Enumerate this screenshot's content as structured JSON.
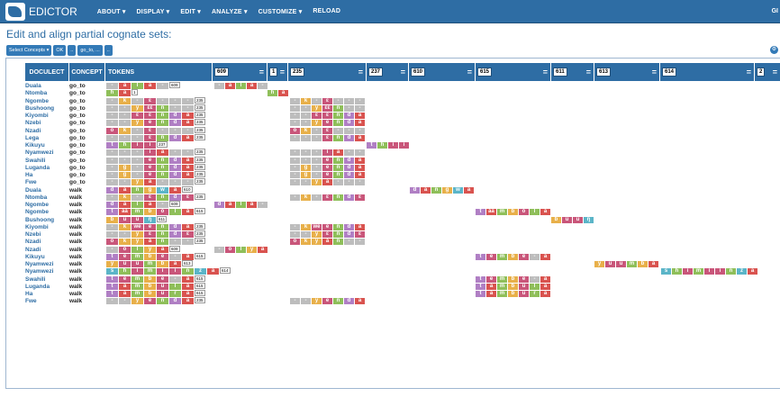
{
  "nav": {
    "brand": "EDICTOR",
    "items": [
      "ABOUT ▾",
      "DISPLAY ▾",
      "EDIT ▾",
      "ANALYZE ▾",
      "CUSTOMIZE ▾",
      "RELOAD"
    ],
    "right": "GI"
  },
  "page": {
    "title": "Edit and align partial cognate sets:"
  },
  "toolbar": {
    "select": "Select Concepts ▾",
    "ok": "OK",
    "prev": "..",
    "concept": "go_to, ...",
    "next": ".."
  },
  "table": {
    "headers": {
      "doculect": "DOCULECT",
      "concept": "CONCEPT",
      "tokens": "TOKENS"
    },
    "cogsets": [
      "609",
      "1",
      "235",
      "237",
      "610",
      "615",
      "611",
      "613",
      "614",
      "2"
    ],
    "rows": [
      {
        "doculect": "Duala",
        "concept": "go_to",
        "tokens": [
          "-",
          "a",
          "l",
          "a",
          "-"
        ],
        "cog": "609"
      },
      {
        "doculect": "Ntomba",
        "concept": "go_to",
        "tokens": [
          "h",
          "a"
        ],
        "cog": "1"
      },
      {
        "doculect": "Ngombe",
        "concept": "go_to",
        "tokens": [
          "-",
          "k",
          "-",
          "ɛ",
          "-",
          "-",
          "-"
        ],
        "cog": "235"
      },
      {
        "doculect": "Bushoong",
        "concept": "go_to",
        "tokens": [
          "-",
          "-",
          "y",
          "ɛɛ",
          "n",
          "-",
          "-"
        ],
        "cog": "235"
      },
      {
        "doculect": "Kiyombi",
        "concept": "go_to",
        "tokens": [
          "-",
          "-",
          "ɛ",
          "ɛ",
          "n",
          "d",
          "a"
        ],
        "cog": "235"
      },
      {
        "doculect": "Nzebi",
        "concept": "go_to",
        "tokens": [
          "-",
          "-",
          "y",
          "e",
          "n",
          "d",
          "a"
        ],
        "cog": "235"
      },
      {
        "doculect": "Nzadi",
        "concept": "go_to",
        "tokens": [
          "o",
          "k",
          "-",
          "ɛ",
          "-",
          "-",
          "-"
        ],
        "cog": "235"
      },
      {
        "doculect": "Lega",
        "concept": "go_to",
        "tokens": [
          "-",
          "-",
          "-",
          "ɛ",
          "n",
          "d",
          "a"
        ],
        "cog": "235"
      },
      {
        "doculect": "Kikuyu",
        "concept": "go_to",
        "tokens": [
          "t",
          "h",
          "i",
          "i"
        ],
        "cog": "237"
      },
      {
        "doculect": "Nyamwezi",
        "concept": "go_to",
        "tokens": [
          "-",
          "-",
          "-",
          "i",
          "a",
          "-",
          "-"
        ],
        "cog": "235"
      },
      {
        "doculect": "Swahili",
        "concept": "go_to",
        "tokens": [
          "-",
          "-",
          "-",
          "e",
          "n",
          "d",
          "a"
        ],
        "cog": "235"
      },
      {
        "doculect": "Luganda",
        "concept": "go_to",
        "tokens": [
          "-",
          "g",
          "-",
          "e",
          "n",
          "d",
          "a"
        ],
        "cog": "235"
      },
      {
        "doculect": "Ha",
        "concept": "go_to",
        "tokens": [
          "-",
          "g",
          "-",
          "e",
          "n",
          "d",
          "a"
        ],
        "cog": "235"
      },
      {
        "doculect": "Fwe",
        "concept": "go_to",
        "tokens": [
          "-",
          "-",
          "y",
          "a",
          "-",
          "-",
          "-"
        ],
        "cog": "235"
      },
      {
        "doculect": "Duala",
        "concept": "walk",
        "tokens": [
          "d",
          "a",
          "n",
          "g",
          "w",
          "a"
        ],
        "cog": "610"
      },
      {
        "doculect": "Ntomba",
        "concept": "walk",
        "tokens": [
          "-",
          "k",
          "-",
          "ɛ",
          "n",
          "d",
          "ɛ"
        ],
        "cog": "235"
      },
      {
        "doculect": "Ngombe",
        "concept": "walk",
        "tokens": [
          "d",
          "a",
          "l",
          "a",
          "-"
        ],
        "cog": "609"
      },
      {
        "doculect": "Ngombe",
        "concept": "walk",
        "tokens": [
          "t",
          "áà",
          "m",
          "b",
          "ò",
          "l",
          "à"
        ],
        "cog": "615"
      },
      {
        "doculect": "Bushoong",
        "concept": "walk",
        "tokens": [
          "b",
          "u",
          "u",
          "ŋ"
        ],
        "cog": "611"
      },
      {
        "doculect": "Kiyombi",
        "concept": "walk",
        "tokens": [
          "-",
          "k",
          "we",
          "e",
          "n",
          "d",
          "a"
        ],
        "cog": "235"
      },
      {
        "doculect": "Nzebi",
        "concept": "walk",
        "tokens": [
          "-",
          "-",
          "y",
          "ɛ",
          "n",
          "d",
          "ɛ"
        ],
        "cog": "235"
      },
      {
        "doculect": "Nzadi",
        "concept": "walk",
        "tokens": [
          "o",
          "k",
          "y",
          "á",
          "n",
          "-",
          "-"
        ],
        "cog": "235"
      },
      {
        "doculect": "Nzadi",
        "concept": "walk",
        "tokens": [
          "-",
          "o",
          "l",
          "y",
          "a"
        ],
        "cog": "609"
      },
      {
        "doculect": "Kikuyu",
        "concept": "walk",
        "tokens": [
          "t",
          "e",
          "m",
          "b",
          "e",
          "-",
          "a"
        ],
        "cog": "615"
      },
      {
        "doculect": "Nyamwezi",
        "concept": "walk",
        "tokens": [
          "y",
          "u",
          "u",
          "m",
          "b",
          "a"
        ],
        "cog": "613"
      },
      {
        "doculect": "Nyamwezi",
        "concept": "walk",
        "tokens": [
          "s",
          "h",
          "i",
          "m",
          "i",
          "i",
          "n",
          "z",
          "a"
        ],
        "cog": "614"
      },
      {
        "doculect": "Swahili",
        "concept": "walk",
        "tokens": [
          "t",
          "e",
          "m",
          "b",
          "e",
          "-",
          "a"
        ],
        "cog": "615"
      },
      {
        "doculect": "Luganda",
        "concept": "walk",
        "tokens": [
          "t",
          "a",
          "m",
          "b",
          "u",
          "l",
          "a"
        ],
        "cog": "615"
      },
      {
        "doculect": "Ha",
        "concept": "walk",
        "tokens": [
          "t",
          "a",
          "m",
          "b",
          "u",
          "r",
          "a"
        ],
        "cog": "615"
      },
      {
        "doculect": "Fwe",
        "concept": "walk",
        "tokens": [
          "-",
          "-",
          "y",
          "e",
          "n",
          "d",
          "a"
        ],
        "cog": "235"
      }
    ]
  },
  "colors": {
    "gap": "#bdbdbd",
    "a": "#d9534f",
    "vowel": "#c9567a",
    "palette": [
      "#b07fc4",
      "#d46b6b",
      "#8fbf5a",
      "#e8b04a",
      "#5bb5c8",
      "#c9567a"
    ]
  }
}
